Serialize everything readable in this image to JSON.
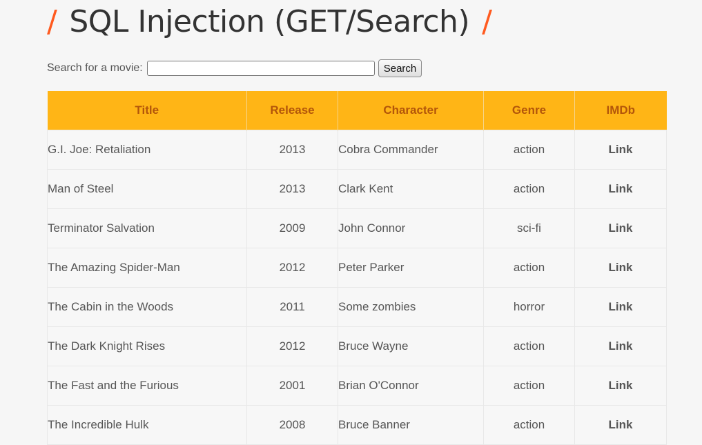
{
  "heading": {
    "slash_left": "/",
    "text": "SQL Injection (GET/Search)",
    "slash_right": "/",
    "accent_color": "#ff5a1f"
  },
  "search": {
    "label": "Search for a movie:",
    "value": "",
    "placeholder": "",
    "button_label": "Search"
  },
  "table": {
    "header_color": "#ffb516",
    "columns": [
      "Title",
      "Release",
      "Character",
      "Genre",
      "IMDb"
    ],
    "rows": [
      {
        "title": "G.I. Joe: Retaliation",
        "release": "2013",
        "character": "Cobra Commander",
        "genre": "action",
        "imdb": "Link"
      },
      {
        "title": "Man of Steel",
        "release": "2013",
        "character": "Clark Kent",
        "genre": "action",
        "imdb": "Link"
      },
      {
        "title": "Terminator Salvation",
        "release": "2009",
        "character": "John Connor",
        "genre": "sci-fi",
        "imdb": "Link"
      },
      {
        "title": "The Amazing Spider-Man",
        "release": "2012",
        "character": "Peter Parker",
        "genre": "action",
        "imdb": "Link"
      },
      {
        "title": "The Cabin in the Woods",
        "release": "2011",
        "character": "Some zombies",
        "genre": "horror",
        "imdb": "Link"
      },
      {
        "title": "The Dark Knight Rises",
        "release": "2012",
        "character": "Bruce Wayne",
        "genre": "action",
        "imdb": "Link"
      },
      {
        "title": "The Fast and the Furious",
        "release": "2001",
        "character": "Brian O'Connor",
        "genre": "action",
        "imdb": "Link"
      },
      {
        "title": "The Incredible Hulk",
        "release": "2008",
        "character": "Bruce Banner",
        "genre": "action",
        "imdb": "Link"
      }
    ]
  }
}
